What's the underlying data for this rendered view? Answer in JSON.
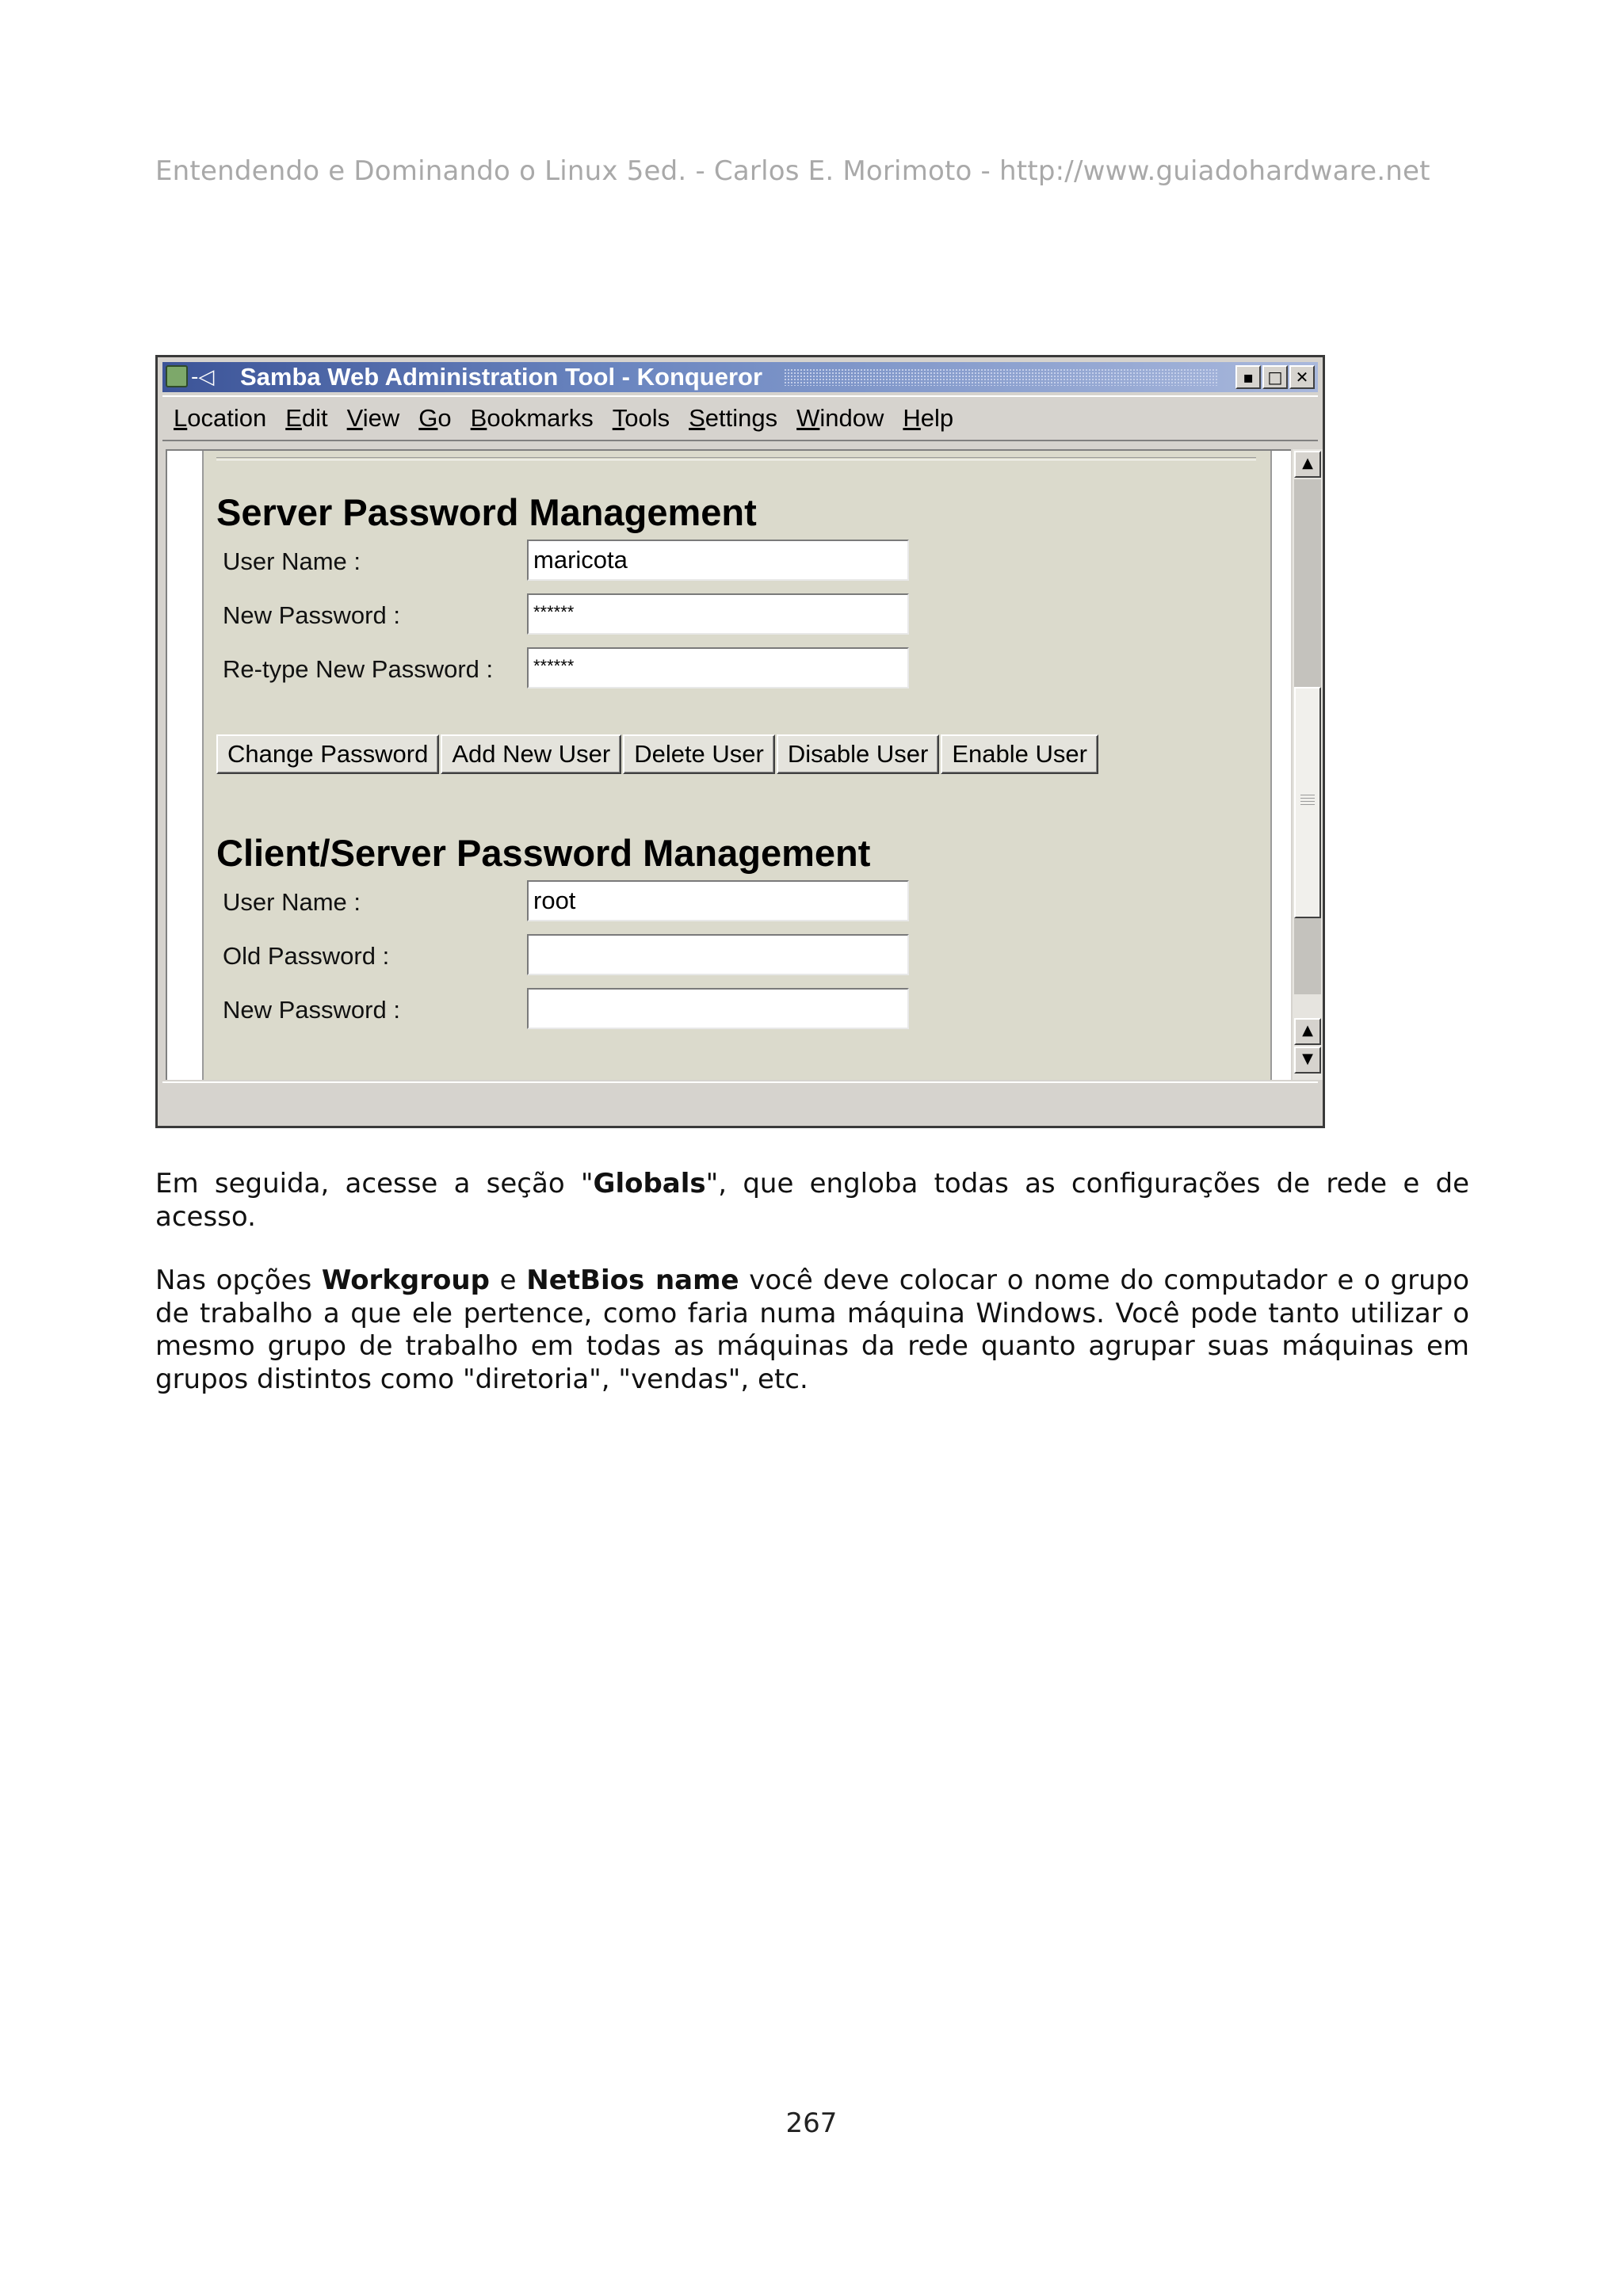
{
  "header": {
    "text": "Entendendo e Dominando o Linux 5ed. - Carlos E. Morimoto - http://www.guiadohardware.net"
  },
  "window": {
    "title": "Samba Web Administration Tool - Konqueror",
    "pin_glyph": "-◁",
    "controls": {
      "minimize": "▪",
      "maximize": "□",
      "close": "✕"
    },
    "menu": [
      {
        "mnemonic": "L",
        "rest": "ocation"
      },
      {
        "mnemonic": "E",
        "rest": "dit"
      },
      {
        "mnemonic": "V",
        "rest": "iew"
      },
      {
        "mnemonic": "G",
        "rest": "o"
      },
      {
        "mnemonic": "B",
        "rest": "ookmarks"
      },
      {
        "mnemonic": "T",
        "rest": "ools"
      },
      {
        "mnemonic": "S",
        "rest": "ettings"
      },
      {
        "mnemonic": "W",
        "rest": "indow"
      },
      {
        "mnemonic": "H",
        "rest": "elp"
      }
    ],
    "scroll": {
      "up": "▲",
      "down": "▼"
    }
  },
  "server_section": {
    "title": "Server Password Management",
    "fields": [
      {
        "label": "User Name :",
        "value": "maricota"
      },
      {
        "label": "New Password :",
        "value": "******"
      },
      {
        "label": "Re-type New Password :",
        "value": "******"
      }
    ],
    "buttons": [
      "Change Password",
      "Add New User",
      "Delete User",
      "Disable User",
      "Enable User"
    ]
  },
  "client_section": {
    "title": "Client/Server Password Management",
    "fields": [
      {
        "label": "User Name :",
        "value": "root"
      },
      {
        "label": "Old Password :",
        "value": ""
      },
      {
        "label": "New Password :",
        "value": ""
      }
    ]
  },
  "body": {
    "p1": {
      "before": "Em seguida, acesse a seção \"",
      "bold": "Globals",
      "after": "\", que engloba todas as configurações de rede e de acesso."
    },
    "p2": {
      "part1": "Nas opções ",
      "bold1": "Workgroup",
      "part2": " e ",
      "bold2": "NetBios name",
      "part3": " você deve colocar o nome do computador e o grupo de trabalho a que ele pertence, como faria numa máquina Windows. Você pode tanto utilizar o mesmo grupo de trabalho em todas as máquinas da rede quanto agrupar suas máquinas em grupos distintos como \"diretoria\", \"vendas\", etc."
    }
  },
  "footer": {
    "page_number": "267"
  }
}
